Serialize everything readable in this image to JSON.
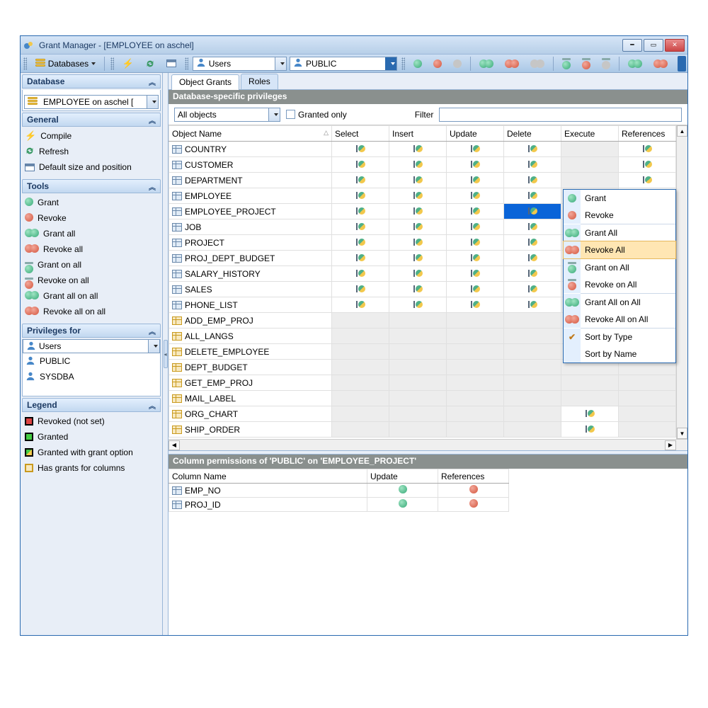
{
  "window": {
    "title": "Grant Manager - [EMPLOYEE on aschel]"
  },
  "toolbar": {
    "databases_label": "Databases",
    "users_combo": "Users",
    "public_combo": "PUBLIC"
  },
  "sidebar": {
    "database_head": "Database",
    "database_value": "EMPLOYEE on aschel [",
    "general_head": "General",
    "general_items": [
      "Compile",
      "Refresh",
      "Default size and position"
    ],
    "tools_head": "Tools",
    "tools_items": [
      "Grant",
      "Revoke",
      "Grant all",
      "Revoke all",
      "Grant on all",
      "Revoke on all",
      "Grant all on all",
      "Revoke all on all"
    ],
    "priv_head": "Privileges for",
    "priv_combo": "Users",
    "priv_list": [
      "PUBLIC",
      "SYSDBA"
    ],
    "legend_head": "Legend",
    "legend_items": [
      "Revoked (not set)",
      "Granted",
      "Granted with grant option",
      "Has grants for columns"
    ]
  },
  "tabs": {
    "object_grants": "Object Grants",
    "roles": "Roles"
  },
  "section": {
    "priv_title": "Database-specific privileges",
    "col_perm_title": "Column permissions of 'PUBLIC' on 'EMPLOYEE_PROJECT'"
  },
  "filter": {
    "all_objects": "All objects",
    "granted_only": "Granted only",
    "filter_label": "Filter"
  },
  "columns": [
    "Object Name",
    "Select",
    "Insert",
    "Update",
    "Delete",
    "Execute",
    "References"
  ],
  "objects": [
    {
      "name": "COUNTRY",
      "type": "table",
      "perms": [
        "g",
        "g",
        "g",
        "g",
        "",
        "g"
      ]
    },
    {
      "name": "CUSTOMER",
      "type": "table",
      "perms": [
        "g",
        "g",
        "g",
        "g",
        "",
        "g"
      ]
    },
    {
      "name": "DEPARTMENT",
      "type": "table",
      "perms": [
        "g",
        "g",
        "g",
        "g",
        "",
        "g"
      ]
    },
    {
      "name": "EMPLOYEE",
      "type": "table",
      "perms": [
        "g",
        "g",
        "g",
        "g",
        "",
        "g"
      ]
    },
    {
      "name": "EMPLOYEE_PROJECT",
      "type": "table",
      "perms": [
        "g",
        "g",
        "g",
        "H",
        "",
        ""
      ]
    },
    {
      "name": "JOB",
      "type": "table",
      "perms": [
        "g",
        "g",
        "g",
        "g",
        "",
        ""
      ]
    },
    {
      "name": "PROJECT",
      "type": "table",
      "perms": [
        "g",
        "g",
        "g",
        "g",
        "",
        ""
      ]
    },
    {
      "name": "PROJ_DEPT_BUDGET",
      "type": "table",
      "perms": [
        "g",
        "g",
        "g",
        "g",
        "",
        ""
      ]
    },
    {
      "name": "SALARY_HISTORY",
      "type": "table",
      "perms": [
        "g",
        "g",
        "g",
        "g",
        "",
        ""
      ]
    },
    {
      "name": "SALES",
      "type": "table",
      "perms": [
        "g",
        "g",
        "g",
        "g",
        "",
        ""
      ]
    },
    {
      "name": "PHONE_LIST",
      "type": "view",
      "perms": [
        "g",
        "g",
        "g",
        "g",
        "",
        ""
      ]
    },
    {
      "name": "ADD_EMP_PROJ",
      "type": "proc",
      "perms": [
        "s",
        "s",
        "s",
        "s",
        "",
        ""
      ]
    },
    {
      "name": "ALL_LANGS",
      "type": "proc",
      "perms": [
        "s",
        "s",
        "s",
        "s",
        "",
        ""
      ]
    },
    {
      "name": "DELETE_EMPLOYEE",
      "type": "proc",
      "perms": [
        "s",
        "s",
        "s",
        "s",
        "",
        ""
      ]
    },
    {
      "name": "DEPT_BUDGET",
      "type": "proc",
      "perms": [
        "s",
        "s",
        "s",
        "s",
        "",
        ""
      ]
    },
    {
      "name": "GET_EMP_PROJ",
      "type": "proc",
      "perms": [
        "s",
        "s",
        "s",
        "s",
        "",
        ""
      ]
    },
    {
      "name": "MAIL_LABEL",
      "type": "proc",
      "perms": [
        "s",
        "s",
        "s",
        "s",
        "",
        ""
      ]
    },
    {
      "name": "ORG_CHART",
      "type": "proc",
      "perms": [
        "s",
        "s",
        "s",
        "s",
        "e",
        ""
      ]
    },
    {
      "name": "SHIP_ORDER",
      "type": "proc",
      "perms": [
        "s",
        "s",
        "s",
        "s",
        "e",
        ""
      ]
    }
  ],
  "col_perm_columns": [
    "Column Name",
    "Update",
    "References"
  ],
  "col_perm_rows": [
    {
      "name": "EMP_NO",
      "update": "green",
      "refs": "red"
    },
    {
      "name": "PROJ_ID",
      "update": "green",
      "refs": "red"
    }
  ],
  "context_menu": {
    "items": [
      "Grant",
      "Revoke",
      "Grant All",
      "Revoke All",
      "Grant on All",
      "Revoke on All",
      "Grant All on All",
      "Revoke All on All",
      "Sort by Type",
      "Sort by Name"
    ],
    "highlighted": 3,
    "checked": 8
  }
}
